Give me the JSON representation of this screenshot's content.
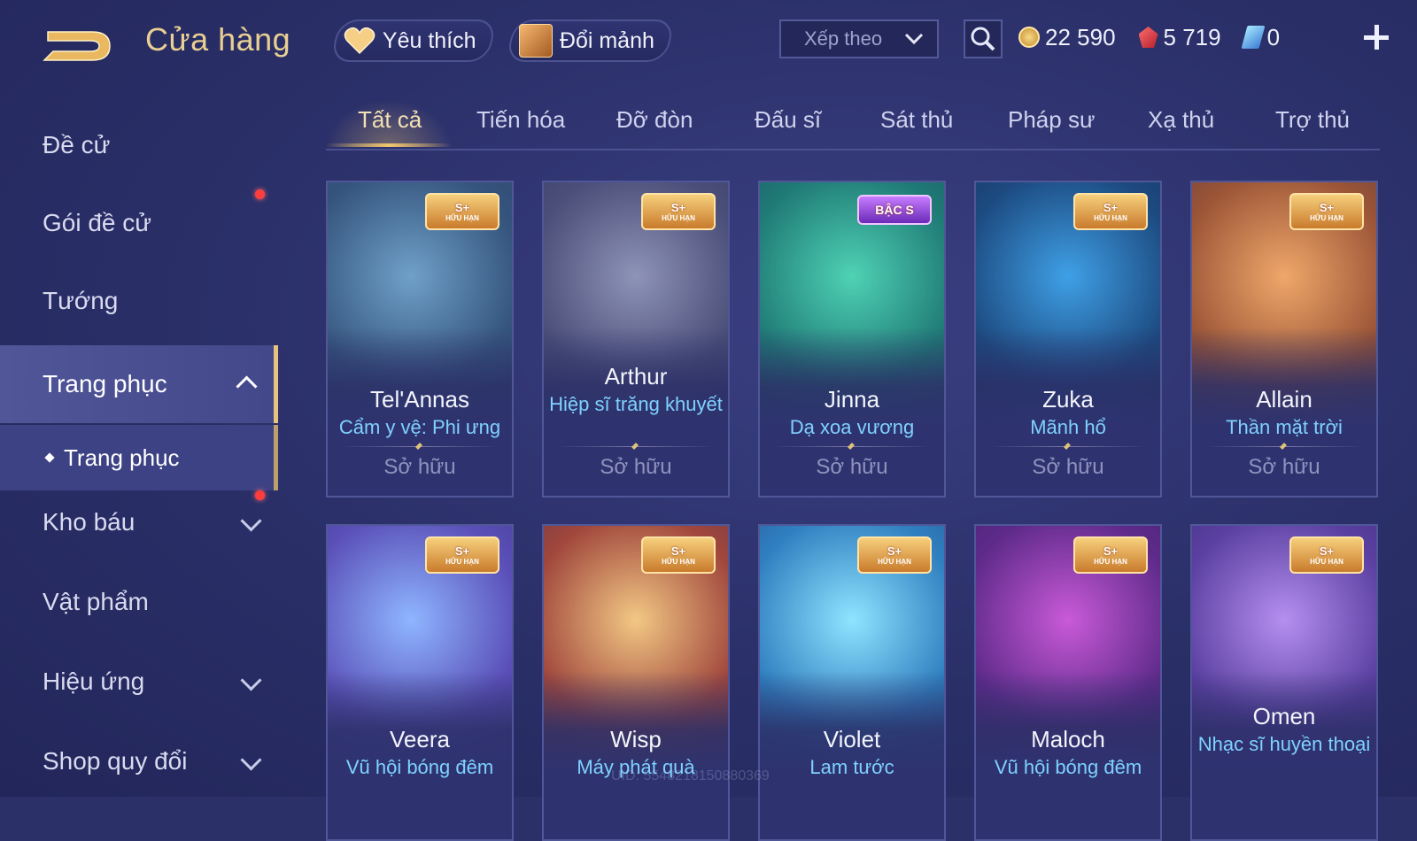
{
  "header": {
    "title": "Cửa hàng",
    "favorites_label": "Yêu thích",
    "exchange_label": "Đổi mảnh",
    "sort_label": "Xếp theo",
    "currencies": {
      "gold": "22 590",
      "ruby": "5 719",
      "voucher": "0"
    }
  },
  "sidebar": {
    "items": [
      {
        "label": "Đề cử"
      },
      {
        "label": "Gói đề cử"
      },
      {
        "label": "Tướng"
      },
      {
        "label": "Trang phục"
      },
      {
        "label": "Kho báu"
      },
      {
        "label": "Vật phẩm"
      },
      {
        "label": "Hiệu ứng"
      },
      {
        "label": "Shop quy đổi"
      }
    ],
    "sub_item": "Trang phục"
  },
  "tabs": [
    "Tất cả",
    "Tiến hóa",
    "Đỡ đòn",
    "Đấu sĩ",
    "Sát thủ",
    "Pháp sư",
    "Xạ thủ",
    "Trợ thủ"
  ],
  "badges": {
    "limited_top": "S+",
    "limited_bottom": "HỮU HẠN",
    "rank": "BẬC S"
  },
  "owned_label": "Sở hữu",
  "cards": [
    {
      "hero": "Tel'Annas",
      "skin": "Cẩm y vệ: Phi ưng",
      "status": "Sở hữu"
    },
    {
      "hero": "Arthur",
      "skin": "Hiệp sĩ trăng khuyết",
      "status": "Sở hữu"
    },
    {
      "hero": "Jinna",
      "skin": "Dạ xoa vương",
      "status": "Sở hữu"
    },
    {
      "hero": "Zuka",
      "skin": "Mãnh hổ",
      "status": "Sở hữu"
    },
    {
      "hero": "Allain",
      "skin": "Thần mặt trời",
      "status": "Sở hữu"
    },
    {
      "hero": "Veera",
      "skin": "Vũ hội bóng đêm"
    },
    {
      "hero": "Wisp",
      "skin": "Máy phát quà"
    },
    {
      "hero": "Violet",
      "skin": "Lam tước"
    },
    {
      "hero": "Maloch",
      "skin": "Vũ hội bóng đêm"
    },
    {
      "hero": "Omen",
      "skin": "Nhạc sĩ huyền thoại"
    }
  ],
  "watermark": "UID: 5548218150880369",
  "colors": {
    "background": "#2b3068",
    "accent_gold": "#e9cf92",
    "skin_name_blue": "#7fd1ff",
    "notification_red": "#ff3d3d"
  }
}
